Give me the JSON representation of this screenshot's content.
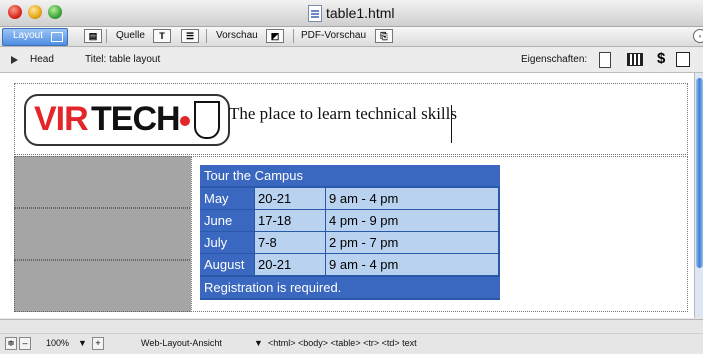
{
  "window": {
    "title": "table1.html"
  },
  "toolbar": {
    "layout_label": "Layout",
    "quelle_label": "Quelle",
    "vorschau_label": "Vorschau",
    "pdf_vorschau_label": "PDF-Vorschau"
  },
  "subbar": {
    "head_label": "Head",
    "title_label": "Titel: table layout",
    "eigenschaften_label": "Eigenschaften:"
  },
  "page": {
    "logo_text_red": "VIR",
    "logo_text_black": "TECH",
    "tagline": "The place to learn technical skills"
  },
  "tour_table": {
    "title": "Tour the Campus",
    "rows": [
      {
        "month": "May",
        "date": "20-21",
        "time": "9 am - 4 pm"
      },
      {
        "month": "June",
        "date": "17-18",
        "time": "4 pm - 9 pm"
      },
      {
        "month": "July",
        "date": "7-8",
        "time": "2 pm - 7 pm"
      },
      {
        "month": "August",
        "date": "20-21",
        "time": "9 am - 4 pm"
      }
    ],
    "footer": "Registration is required."
  },
  "statusbar": {
    "zoom": "100%",
    "view_mode": "Web-Layout-Ansicht",
    "breadcrumb": "<html> <body> <table> <tr> <td> text"
  },
  "colors": {
    "table_header": "#3a67bf",
    "table_cell": "#b9d2f0",
    "side_block": "#a5a5a5",
    "logo_red": "#e3262a"
  },
  "icons": [
    "close-icon",
    "minimize-icon",
    "zoom-icon",
    "document-icon",
    "play-icon",
    "properties-icon"
  ]
}
